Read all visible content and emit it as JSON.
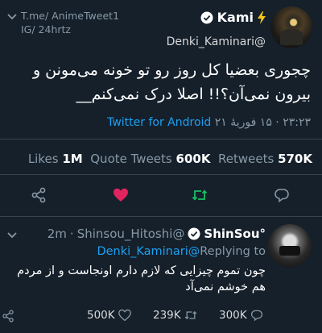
{
  "watermark": {
    "line1": "T.me/ AnimeTweet1",
    "line2": "IG/ 24hrtz"
  },
  "tweet": {
    "display_name": "Kami",
    "handle": "Denki_Kaminari@",
    "text": "چجوری بعضیا کل روز رو تو خونه می‌مونن و بیرون نمی‌آن؟!! اصلا درک نمی‌کنم__",
    "timestamp": "۲۳:۲۳ · ۱۵ فوریهٔ ۲۱",
    "source": "Twitter for Android",
    "stats": {
      "likes_count": "1M",
      "likes_label": "Likes",
      "quotes_count": "600K",
      "quotes_label": "Quote Tweets",
      "retweets_count": "570K",
      "retweets_label": "Retweets"
    }
  },
  "reply": {
    "time": "2m",
    "handle": "Shinsou_Hitoshi@",
    "display_name": "ShinSou°",
    "replying_to_handle": "Denki_Kaminari@",
    "replying_to_label": "Replying to",
    "text": "چون تموم چیزایی که لازم دارم اونجاست و از مردم هم خوشم نمی‌آد",
    "likes": "500K",
    "retweets": "239K",
    "replies": "300K"
  },
  "colors": {
    "background": "#15202b",
    "accent": "#1da1f2",
    "like": "#e0245e",
    "retweet": "#17bf63",
    "muted": "#8899a6"
  },
  "icons": [
    "chevron-down-icon",
    "verified-icon",
    "lightning-icon",
    "share-icon",
    "heart-icon",
    "retweet-icon",
    "reply-icon"
  ]
}
